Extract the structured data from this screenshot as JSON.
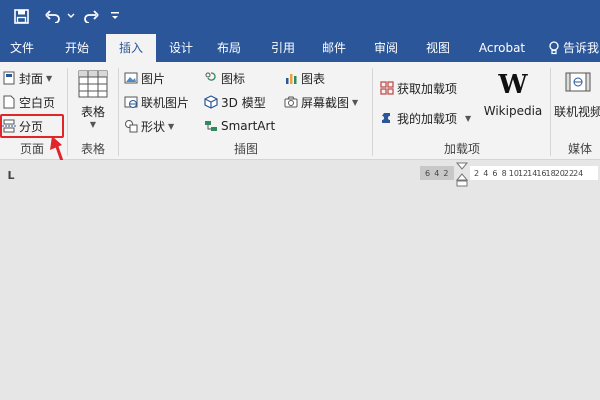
{
  "quick_access": {
    "save_icon": "save-icon",
    "undo_icon": "undo-icon",
    "redo_icon": "redo-icon",
    "customize_icon": "customize-qat-icon"
  },
  "tabs": [
    {
      "label": "文件"
    },
    {
      "label": "开始"
    },
    {
      "label": "插入"
    },
    {
      "label": "设计"
    },
    {
      "label": "布局"
    },
    {
      "label": "引用"
    },
    {
      "label": "邮件"
    },
    {
      "label": "审阅"
    },
    {
      "label": "视图"
    },
    {
      "label": "Acrobat"
    },
    {
      "label": "告诉我"
    }
  ],
  "ribbon": {
    "pages": {
      "cover": "封面",
      "blank": "空白页",
      "break": "分页",
      "label": "页面"
    },
    "tables": {
      "table": "表格",
      "label": "表格"
    },
    "illustrations": {
      "pictures": "图片",
      "online_pictures": "联机图片",
      "shapes": "形状",
      "icons": "图标",
      "models": "3D 模型",
      "smartart": "SmartArt",
      "chart": "图表",
      "screenshot": "屏幕截图",
      "label": "插图"
    },
    "addins": {
      "get": "获取加载项",
      "mine": "我的加载项",
      "wiki_letter": "W",
      "wiki": "Wikipedia",
      "label": "加载项"
    },
    "media": {
      "video": "联机视频",
      "label": "媒体"
    }
  },
  "ruler": {
    "tab_selector": "L",
    "left_numbers": [
      "6",
      "4",
      "2"
    ],
    "right_numbers": [
      "2",
      "4",
      "6",
      "8",
      "10",
      "12",
      "14",
      "16",
      "18",
      "20",
      "22",
      "24"
    ]
  },
  "colors": {
    "accent": "#2b579a",
    "highlight": "#e0262b"
  }
}
